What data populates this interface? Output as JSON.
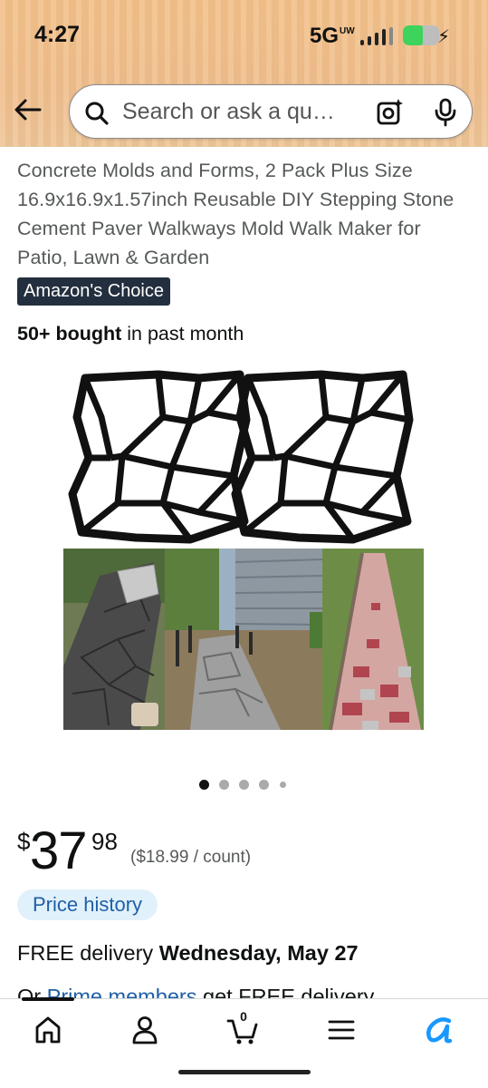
{
  "status_bar": {
    "time": "4:27",
    "network": "5G",
    "network_sup": "UW",
    "battery_color": "#3dd35c"
  },
  "nav": {
    "back_icon": "back-arrow-icon",
    "search_placeholder": "Search or ask a qu…",
    "camera_icon": "camera-lens-icon",
    "mic_icon": "microphone-icon"
  },
  "product": {
    "title": "Concrete Molds and Forms, 2 Pack Plus Size 16.9x16.9x1.57inch Reusable DIY Stepping Stone Cement Paver Walkways Mold Walk Maker for Patio, Lawn & Garden",
    "badge": "Amazon's Choice",
    "bought_bold": "50+ bought",
    "bought_rest": " in past month",
    "image_count": 5,
    "active_image_index": 1
  },
  "price": {
    "symbol": "$",
    "whole": "37",
    "fraction": "98",
    "unit_price": "($18.99 / count)",
    "history_label": "Price history"
  },
  "delivery": {
    "prefix": "FREE delivery ",
    "date": "Wednesday, May 27",
    "prime_prefix": "Or ",
    "prime_link": "Prime members",
    "prime_suffix": " get FREE delivery"
  },
  "bottom_nav": {
    "items": [
      "home-icon",
      "account-icon",
      "cart-icon",
      "menu-icon",
      "rufus-icon"
    ],
    "cart_count": "0",
    "accent": "#1a98ff"
  }
}
